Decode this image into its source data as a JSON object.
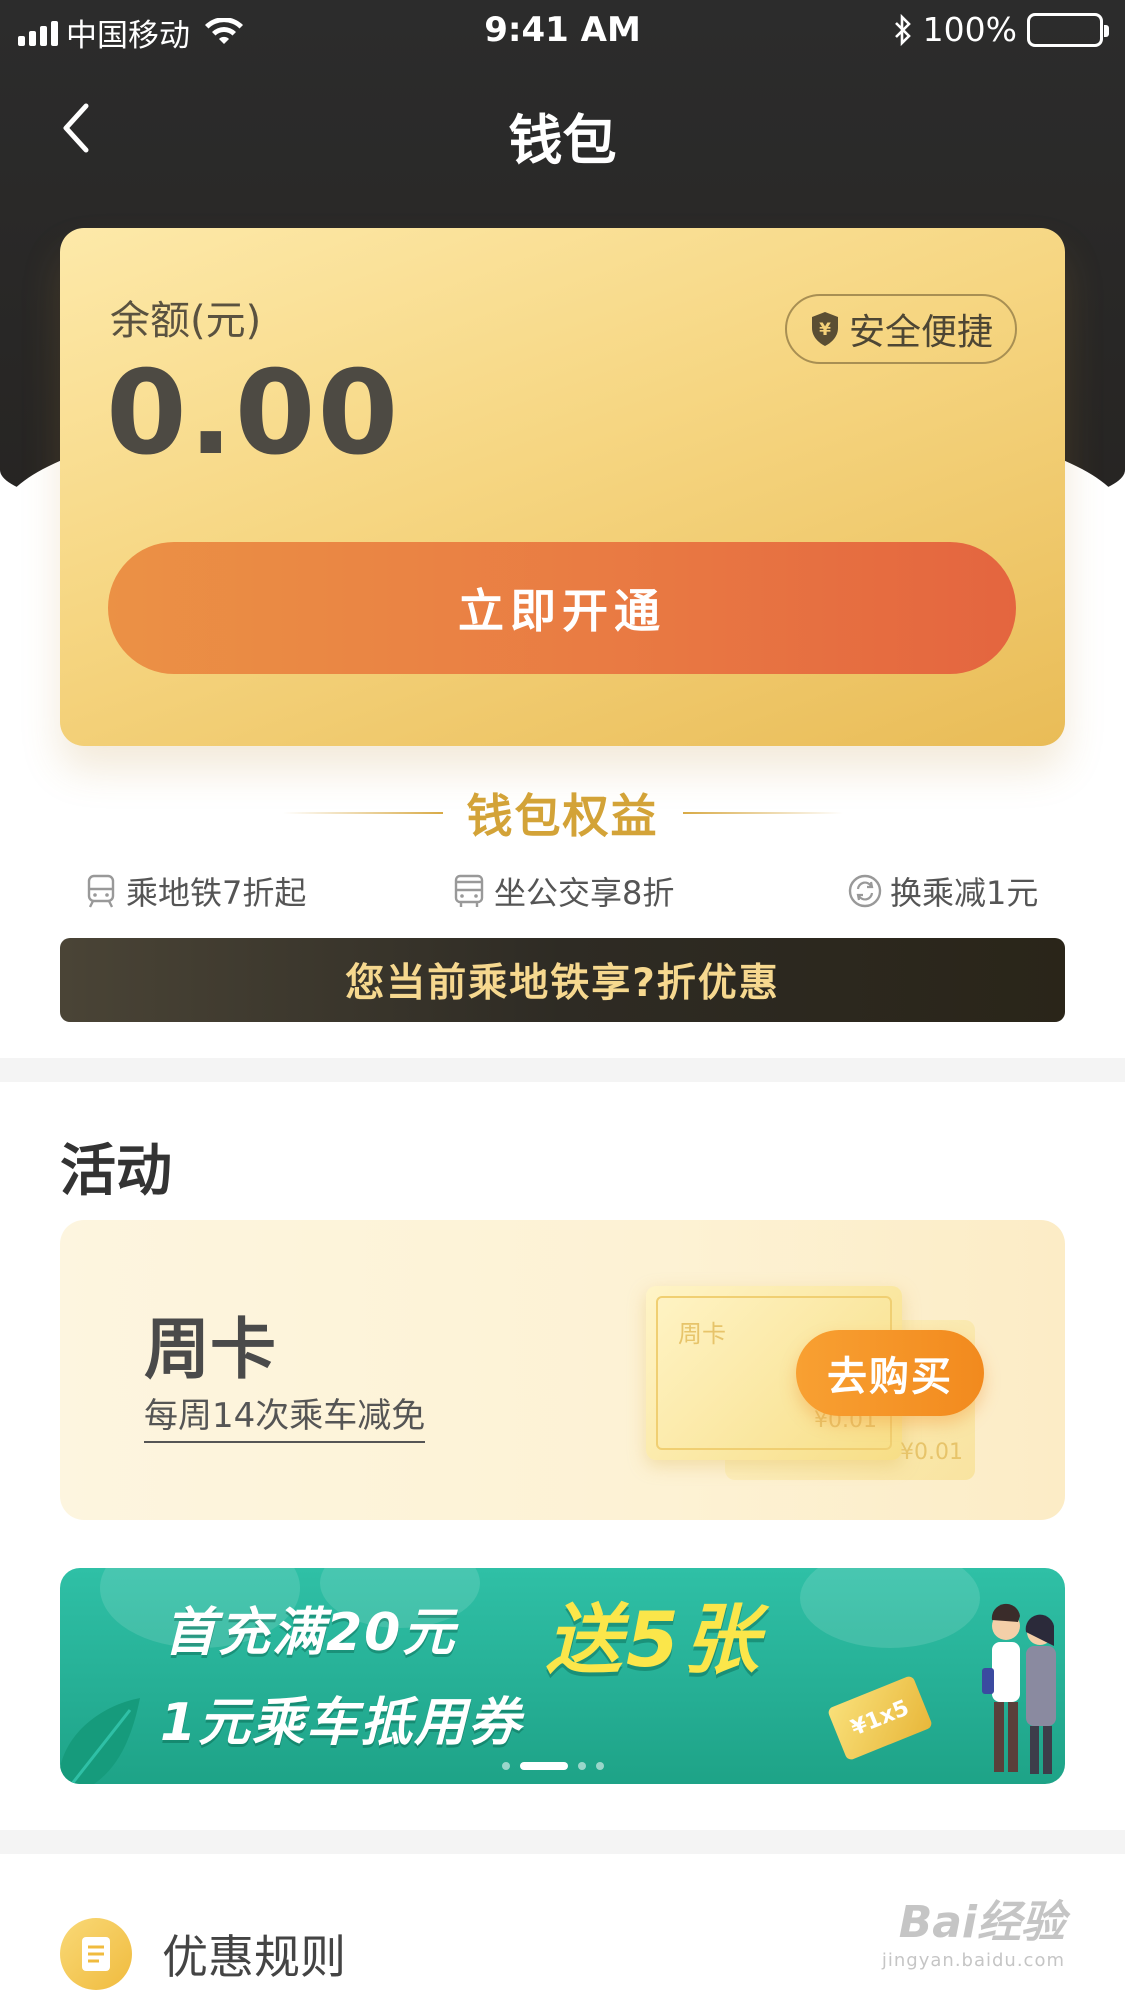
{
  "status_bar": {
    "carrier": "中国移动",
    "time": "9:41 AM",
    "battery": "100%"
  },
  "nav": {
    "title": "钱包"
  },
  "balance_card": {
    "label": "余额(元)",
    "amount": "0.00",
    "badge": "安全便捷",
    "open_button": "立即开通"
  },
  "benefits": {
    "title": "钱包权益",
    "items": [
      {
        "label": "乘地铁7折起",
        "icon": "subway-icon"
      },
      {
        "label": "坐公交享8折",
        "icon": "bus-icon"
      },
      {
        "label": "换乘减1元",
        "icon": "transfer-icon"
      }
    ],
    "discount_text": "您当前乘地铁享?折优惠"
  },
  "activities": {
    "title": "活动",
    "week_card": {
      "title": "周卡",
      "subtitle": "每周14次乘车减免",
      "ticket_label": "周卡",
      "ticket_price": "¥0.01",
      "ticket_price_back": "¥0.01",
      "buy_button": "去购买"
    },
    "promo_banner": {
      "line1": "首充满20元",
      "highlight": "送5张",
      "line2": "1元乘车抵用券",
      "coupon": "¥1x5",
      "dots_count": 4,
      "active_dot": 1
    }
  },
  "rules": {
    "label": "优惠规则"
  },
  "watermark": {
    "main": "Bai经验",
    "sub": "jingyan.baidu.com"
  },
  "colors": {
    "header_bg": "#2a2826",
    "accent_orange": "#e97b43",
    "gold": "#d3a338",
    "promo_green": "#25ae94"
  }
}
